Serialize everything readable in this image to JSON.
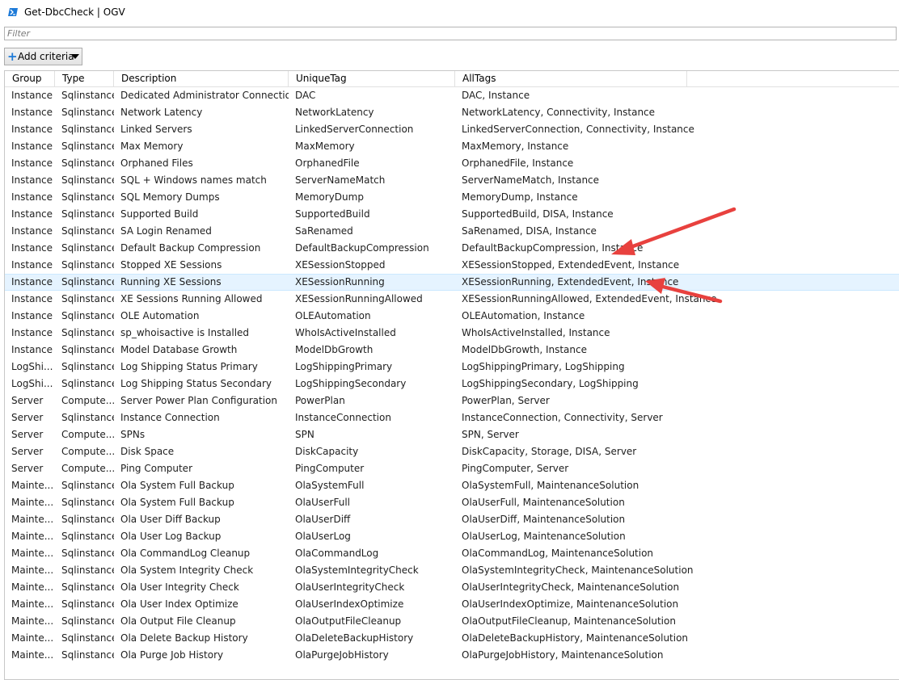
{
  "window": {
    "title": "Get-DbcCheck | OGV",
    "accent": "#1d7ad8"
  },
  "filter": {
    "placeholder": "Filter",
    "value": ""
  },
  "toolbar": {
    "add_criteria_label": "Add criteria"
  },
  "grid": {
    "columns": [
      "Group",
      "Type",
      "Description",
      "UniqueTag",
      "AllTags"
    ],
    "selected_row": 11,
    "highlight_color": "#e5f3ff",
    "annotation_color": "#e8413e",
    "rows": [
      [
        "Instance",
        "Sqlinstance",
        "Dedicated Administrator Connection",
        "DAC",
        "DAC, Instance"
      ],
      [
        "Instance",
        "Sqlinstance",
        "Network Latency",
        "NetworkLatency",
        "NetworkLatency, Connectivity, Instance"
      ],
      [
        "Instance",
        "Sqlinstance",
        "Linked Servers",
        "LinkedServerConnection",
        "LinkedServerConnection, Connectivity, Instance"
      ],
      [
        "Instance",
        "Sqlinstance",
        "Max Memory",
        "MaxMemory",
        "MaxMemory, Instance"
      ],
      [
        "Instance",
        "Sqlinstance",
        "Orphaned Files",
        "OrphanedFile",
        "OrphanedFile, Instance"
      ],
      [
        "Instance",
        "Sqlinstance",
        "SQL + Windows names match",
        "ServerNameMatch",
        "ServerNameMatch, Instance"
      ],
      [
        "Instance",
        "Sqlinstance",
        "SQL Memory Dumps",
        "MemoryDump",
        "MemoryDump, Instance"
      ],
      [
        "Instance",
        "Sqlinstance",
        "Supported Build",
        "SupportedBuild",
        "SupportedBuild, DISA, Instance"
      ],
      [
        "Instance",
        "Sqlinstance",
        "SA Login Renamed",
        "SaRenamed",
        "SaRenamed, DISA, Instance"
      ],
      [
        "Instance",
        "Sqlinstance",
        "Default Backup Compression",
        "DefaultBackupCompression",
        "DefaultBackupCompression, Instance"
      ],
      [
        "Instance",
        "Sqlinstance",
        "Stopped XE Sessions",
        "XESessionStopped",
        "XESessionStopped, ExtendedEvent, Instance"
      ],
      [
        "Instance",
        "Sqlinstance",
        "Running XE Sessions",
        "XESessionRunning",
        "XESessionRunning, ExtendedEvent, Instance"
      ],
      [
        "Instance",
        "Sqlinstance",
        "XE Sessions Running Allowed",
        "XESessionRunningAllowed",
        "XESessionRunningAllowed, ExtendedEvent, Instance"
      ],
      [
        "Instance",
        "Sqlinstance",
        "OLE Automation",
        "OLEAutomation",
        "OLEAutomation, Instance"
      ],
      [
        "Instance",
        "Sqlinstance",
        "sp_whoisactive is Installed",
        "WhoIsActiveInstalled",
        "WhoIsActiveInstalled, Instance"
      ],
      [
        "Instance",
        "Sqlinstance",
        "Model Database Growth",
        "ModelDbGrowth",
        "ModelDbGrowth, Instance"
      ],
      [
        "LogShi...",
        "Sqlinstance",
        "Log Shipping Status Primary",
        "LogShippingPrimary",
        "LogShippingPrimary, LogShipping"
      ],
      [
        "LogShi...",
        "Sqlinstance",
        "Log Shipping Status Secondary",
        "LogShippingSecondary",
        "LogShippingSecondary, LogShipping"
      ],
      [
        "Server",
        "Compute...",
        "Server Power Plan Configuration",
        "PowerPlan",
        "PowerPlan, Server"
      ],
      [
        "Server",
        "Sqlinstance",
        "Instance Connection",
        "InstanceConnection",
        "InstanceConnection, Connectivity, Server"
      ],
      [
        "Server",
        "Compute...",
        "SPNs",
        "SPN",
        "SPN, Server"
      ],
      [
        "Server",
        "Compute...",
        "Disk Space",
        "DiskCapacity",
        "DiskCapacity, Storage, DISA, Server"
      ],
      [
        "Server",
        "Compute...",
        "Ping Computer",
        "PingComputer",
        "PingComputer, Server"
      ],
      [
        "Mainte...",
        "Sqlinstance",
        "Ola System Full Backup",
        "OlaSystemFull",
        "OlaSystemFull, MaintenanceSolution"
      ],
      [
        "Mainte...",
        "Sqlinstance",
        "Ola System Full Backup",
        "OlaUserFull",
        "OlaUserFull, MaintenanceSolution"
      ],
      [
        "Mainte...",
        "Sqlinstance",
        "Ola User Diff Backup",
        "OlaUserDiff",
        "OlaUserDiff, MaintenanceSolution"
      ],
      [
        "Mainte...",
        "Sqlinstance",
        "Ola User Log Backup",
        "OlaUserLog",
        "OlaUserLog, MaintenanceSolution"
      ],
      [
        "Mainte...",
        "Sqlinstance",
        "Ola CommandLog Cleanup",
        "OlaCommandLog",
        "OlaCommandLog, MaintenanceSolution"
      ],
      [
        "Mainte...",
        "Sqlinstance",
        "Ola System Integrity Check",
        "OlaSystemIntegrityCheck",
        "OlaSystemIntegrityCheck, MaintenanceSolution"
      ],
      [
        "Mainte...",
        "Sqlinstance",
        "Ola User Integrity Check",
        "OlaUserIntegrityCheck",
        "OlaUserIntegrityCheck, MaintenanceSolution"
      ],
      [
        "Mainte...",
        "Sqlinstance",
        "Ola User Index Optimize",
        "OlaUserIndexOptimize",
        "OlaUserIndexOptimize, MaintenanceSolution"
      ],
      [
        "Mainte...",
        "Sqlinstance",
        "Ola Output File Cleanup",
        "OlaOutputFileCleanup",
        "OlaOutputFileCleanup, MaintenanceSolution"
      ],
      [
        "Mainte...",
        "Sqlinstance",
        "Ola Delete Backup History",
        "OlaDeleteBackupHistory",
        "OlaDeleteBackupHistory, MaintenanceSolution"
      ],
      [
        "Mainte...",
        "Sqlinstance",
        "Ola Purge Job History",
        "OlaPurgeJobHistory",
        "OlaPurgeJobHistory, MaintenanceSolution"
      ]
    ]
  }
}
